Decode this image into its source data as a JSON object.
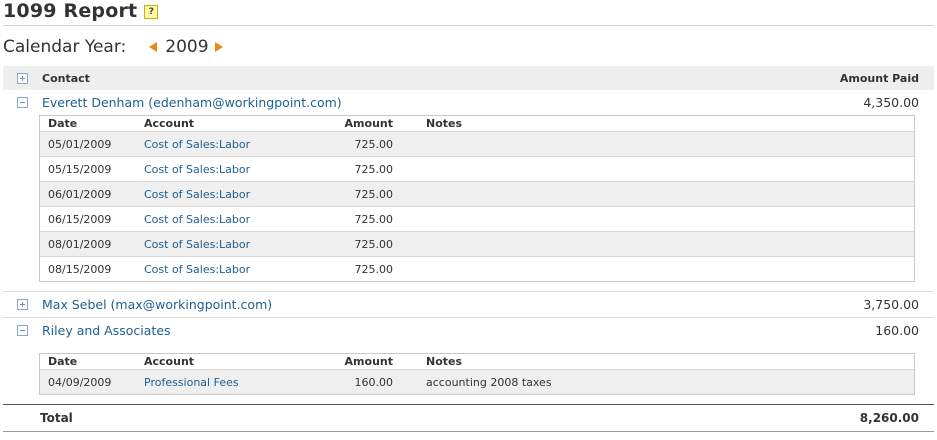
{
  "page": {
    "title": "1099 Report",
    "help_glyph": "?",
    "year_label": "Calendar Year:",
    "year": "2009"
  },
  "table": {
    "contact_header": "Contact",
    "amount_header": "Amount Paid",
    "detail_headers": {
      "date": "Date",
      "account": "Account",
      "amount": "Amount",
      "notes": "Notes"
    },
    "contacts": [
      {
        "name": "Everett Denham (edenham@workingpoint.com)",
        "amount": "4,350.00",
        "expanded": true,
        "rows": [
          {
            "date": "05/01/2009",
            "account": "Cost of Sales:Labor",
            "amount": "725.00",
            "notes": ""
          },
          {
            "date": "05/15/2009",
            "account": "Cost of Sales:Labor",
            "amount": "725.00",
            "notes": ""
          },
          {
            "date": "06/01/2009",
            "account": "Cost of Sales:Labor",
            "amount": "725.00",
            "notes": ""
          },
          {
            "date": "06/15/2009",
            "account": "Cost of Sales:Labor",
            "amount": "725.00",
            "notes": ""
          },
          {
            "date": "08/01/2009",
            "account": "Cost of Sales:Labor",
            "amount": "725.00",
            "notes": ""
          },
          {
            "date": "08/15/2009",
            "account": "Cost of Sales:Labor",
            "amount": "725.00",
            "notes": ""
          }
        ]
      },
      {
        "name": "Max Sebel (max@workingpoint.com)",
        "amount": "3,750.00",
        "expanded": false,
        "rows": []
      },
      {
        "name": "Riley and Associates",
        "amount": "160.00",
        "expanded": true,
        "rows": [
          {
            "date": "04/09/2009",
            "account": "Professional Fees",
            "amount": "160.00",
            "notes": "accounting 2008 taxes"
          }
        ]
      }
    ],
    "total_label": "Total",
    "total_amount": "8,260.00"
  },
  "icons": {
    "help": "help-icon",
    "prev": "prev-year-arrow-icon",
    "next": "next-year-arrow-icon",
    "expand": "expand-icon",
    "collapse": "collapse-icon"
  },
  "colors": {
    "link": "#1f5e91",
    "arrow": "#e08a1c",
    "header_bg": "#eeeeee",
    "alt_row_bg": "#efefef"
  }
}
